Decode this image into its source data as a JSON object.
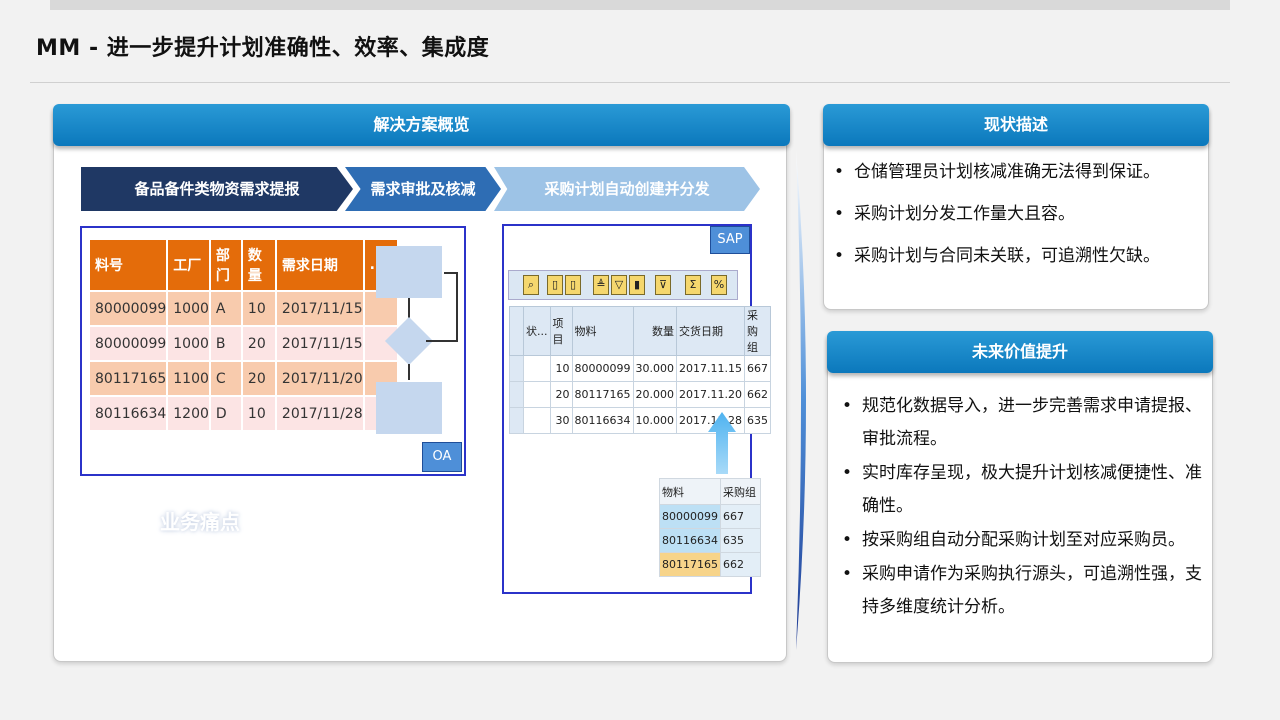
{
  "slide_title": "MM - 进一步提升计划准确性、效率、集成度",
  "solution": {
    "header": "解决方案概览",
    "steps": [
      "备品备件类物资需求提报",
      "需求审批及核减",
      "采购计划自动创建并分发"
    ],
    "pain_label": "业务痛点"
  },
  "oa": {
    "tag": "OA",
    "columns": [
      "料号",
      "工厂",
      "部门",
      "数量",
      "需求日期",
      "..."
    ],
    "rows": [
      [
        "80000099",
        "1000",
        "A",
        "10",
        "2017/11/15",
        ""
      ],
      [
        "80000099",
        "1000",
        "B",
        "20",
        "2017/11/15",
        ""
      ],
      [
        "80117165",
        "1100",
        "C",
        "20",
        "2017/11/20",
        ""
      ],
      [
        "80116634",
        "1200",
        "D",
        "10",
        "2017/11/28",
        ""
      ]
    ]
  },
  "sap": {
    "tag": "SAP",
    "toolbar_icons": [
      "search-icon",
      "copy-icon",
      "doc-icon",
      "filter-icon",
      "sort-icon",
      "export-icon",
      "funnel-icon",
      "sum-icon",
      "percent-icon"
    ],
    "columns": [
      "状...",
      "项目",
      "物料",
      "数量",
      "交货日期",
      "采购组"
    ],
    "rows": [
      [
        "",
        "10",
        "80000099",
        "30.000",
        "2017.11.15",
        "667"
      ],
      [
        "",
        "20",
        "80117165",
        "20.000",
        "2017.11.20",
        "662"
      ],
      [
        "",
        "30",
        "80116634",
        "10.000",
        "2017.11.28",
        "635"
      ]
    ],
    "mapping_columns": [
      "物料",
      "采购组"
    ],
    "mapping_rows": [
      [
        "80000099",
        "667"
      ],
      [
        "80116634",
        "635"
      ],
      [
        "80117165",
        "662"
      ]
    ]
  },
  "status": {
    "header": "现状描述",
    "items": [
      "仓储管理员计划核减准确无法得到保证。",
      "采购计划分发工作量大且容。",
      "采购计划与合同未关联，可追溯性欠缺。"
    ]
  },
  "future": {
    "header": "未来价值提升",
    "items": [
      "规范化数据导入，进一步完善需求申请提报、审批流程。",
      "实时库存呈现，极大提升计划核减便捷性、准确性。",
      "按采购组自动分配采购计划至对应采购员。",
      "采购申请作为采购执行源头，可追溯性强，支持多维度统计分析。"
    ]
  },
  "colors": {
    "header_blue": "#0b78bc",
    "oa_header": "#e46c0a",
    "step_dark": "#1f3864",
    "step_mid": "#2e6db4",
    "step_light": "#9dc3e6"
  }
}
